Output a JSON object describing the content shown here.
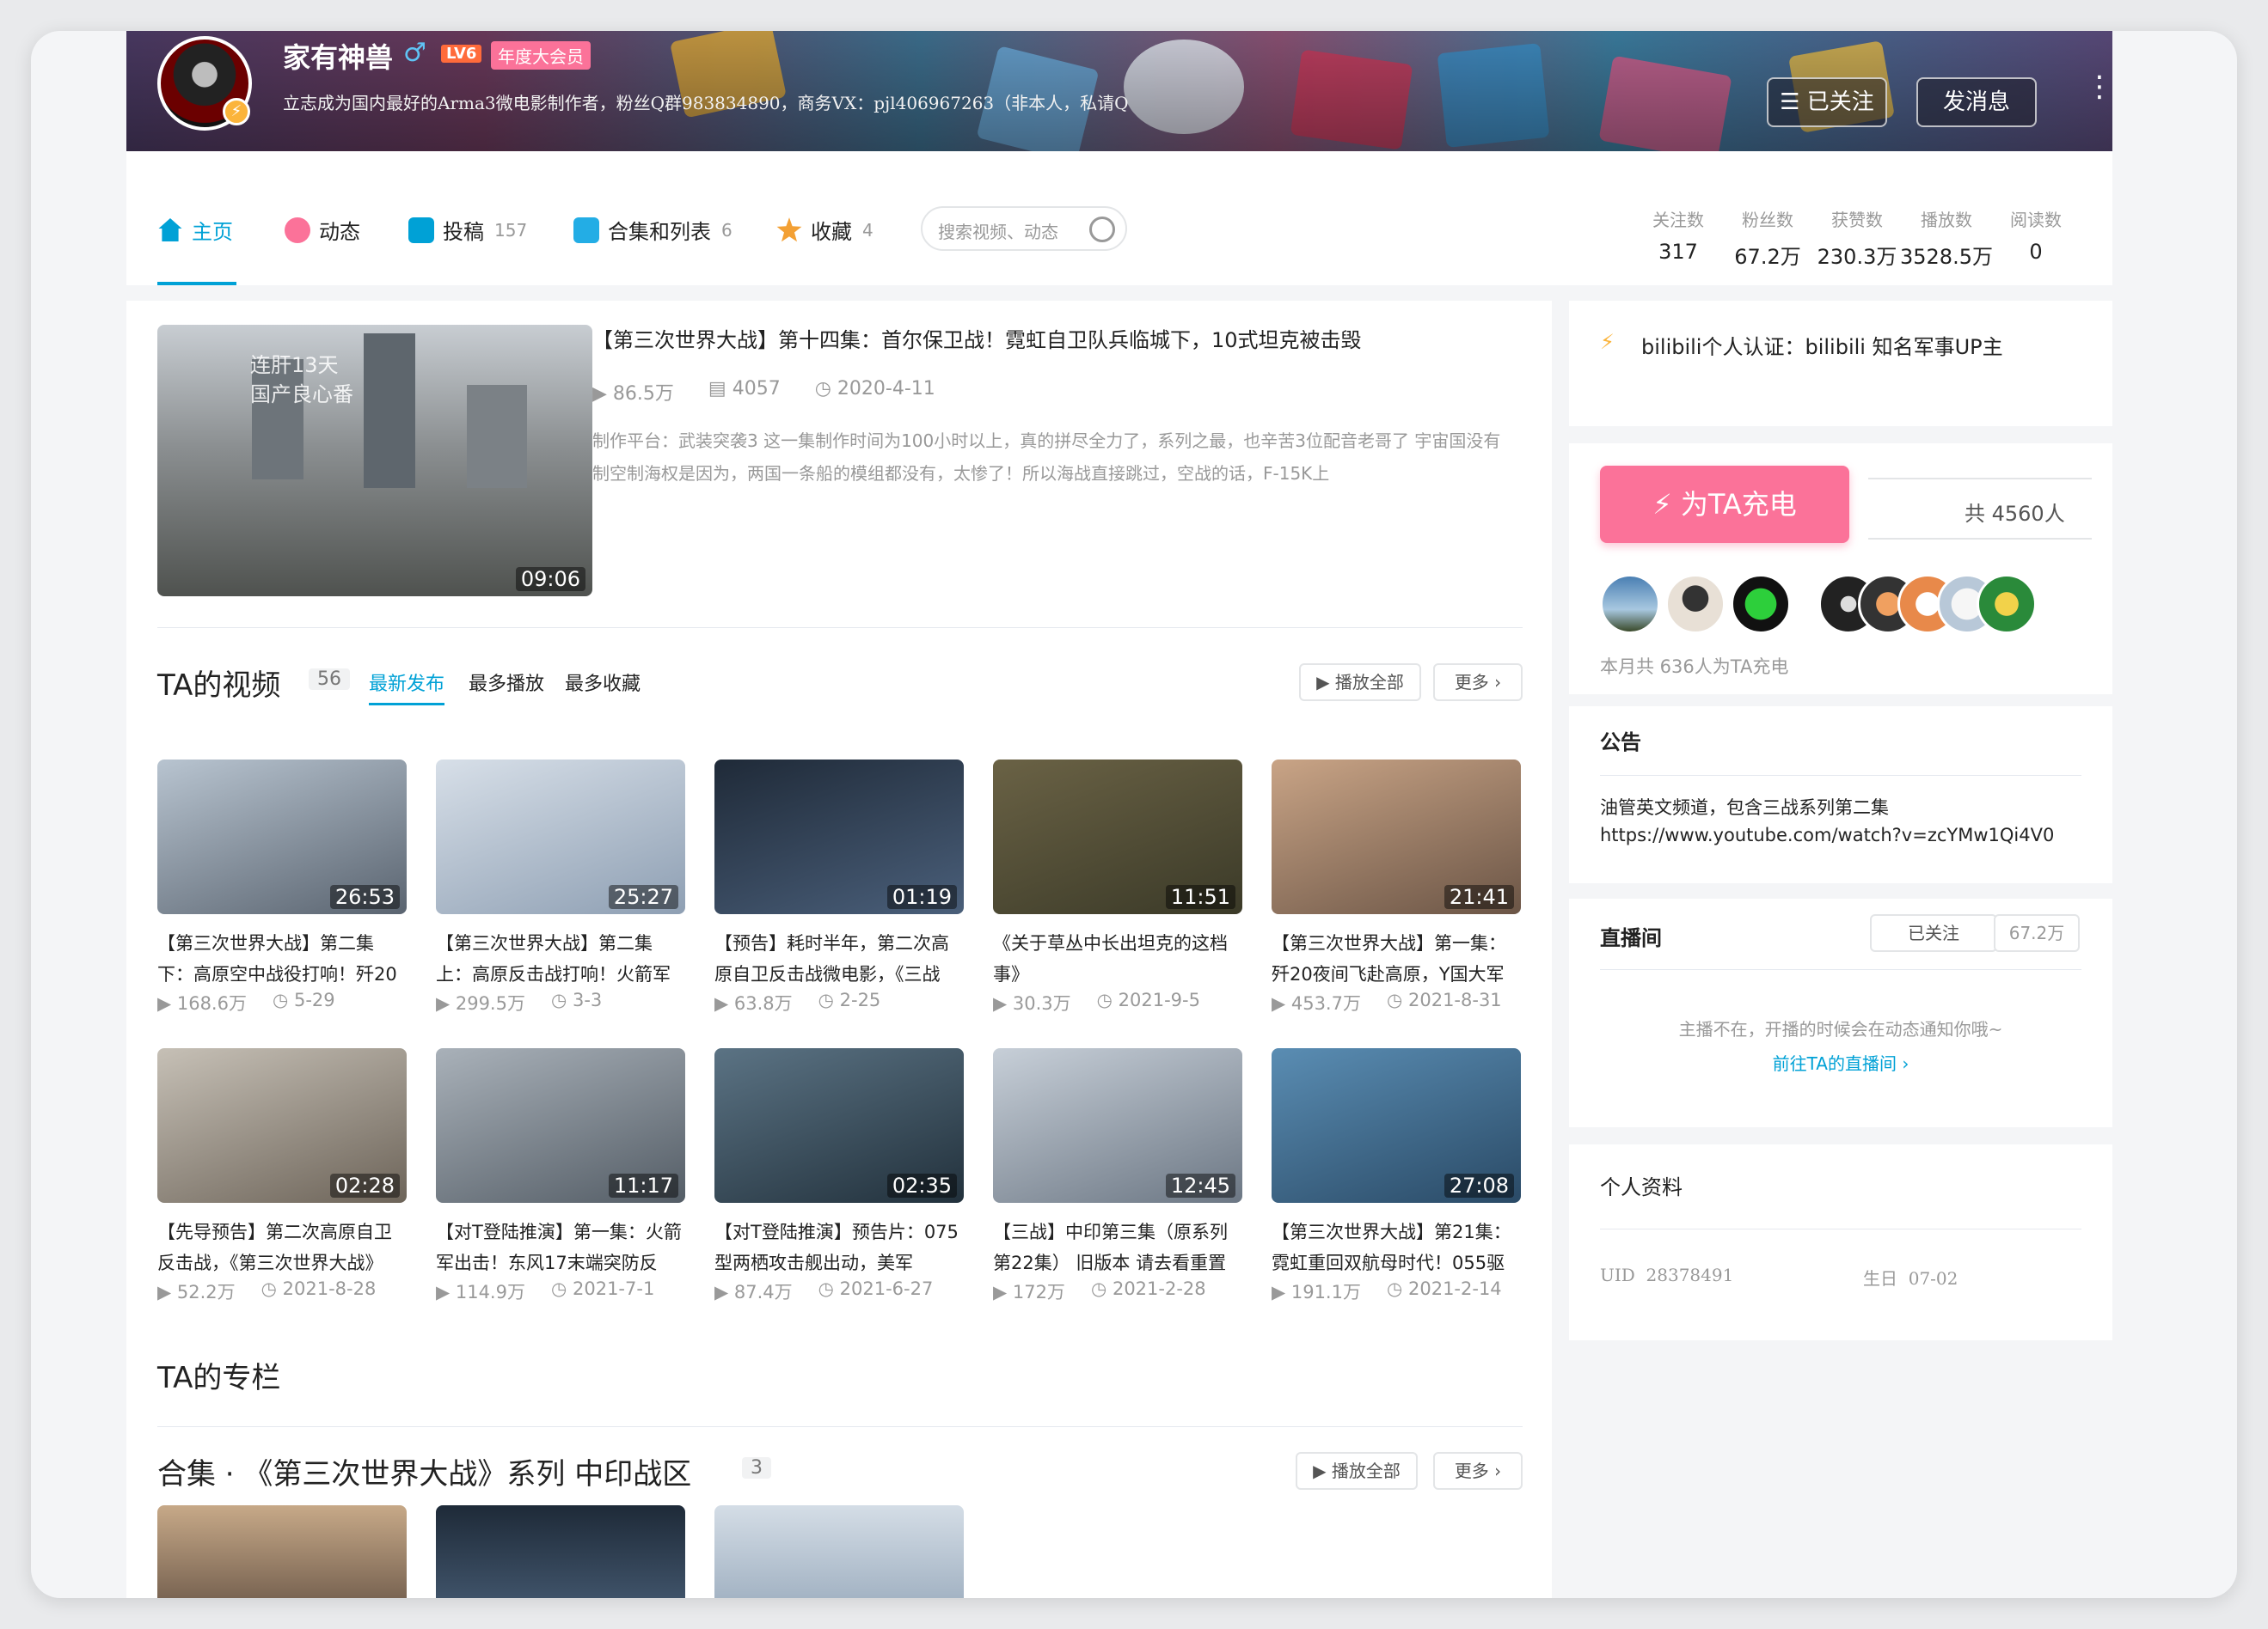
{
  "header": {
    "username": "家有神兽",
    "gender_symbol": "♂",
    "level": "LV6",
    "vip_label": "年度大会员",
    "signature": "立志成为国内最好的Arma3微电影制作者，粉丝Q群983834890，商务VX：pjl406967263（非本人，私请Q",
    "followed_label": "☰ 已关注",
    "message_label": "发消息"
  },
  "nav": {
    "tabs": [
      {
        "label": "主页",
        "count": ""
      },
      {
        "label": "动态",
        "count": ""
      },
      {
        "label": "投稿",
        "count": "157"
      },
      {
        "label": "合集和列表",
        "count": "6"
      },
      {
        "label": "收藏",
        "count": "4"
      }
    ],
    "search_placeholder": "搜索视频、动态",
    "stats": [
      {
        "label": "关注数",
        "value": "317"
      },
      {
        "label": "粉丝数",
        "value": "67.2万"
      },
      {
        "label": "获赞数",
        "value": "230.3万"
      },
      {
        "label": "播放数",
        "value": "3528.5万"
      },
      {
        "label": "阅读数",
        "value": "0"
      }
    ]
  },
  "top_video": {
    "thumb_overlay": "连肝13天\n国产良心番",
    "duration": "09:06",
    "title": "【第三次世界大战】第十四集：首尔保卫战！霓虹自卫队兵临城下，10式坦克被击毁",
    "plays": "86.5万",
    "danmaku": "4057",
    "date": "2020-4-11",
    "desc": "制作平台：武装突袭3 这一集制作时间为100小时以上，真的拼尽全力了，系列之最，也辛苦3位配音老哥了 宇宙国没有制空制海权是因为，两国一条船的模组都没有，太惨了！所以海战直接跳过，空战的话，F-15K上"
  },
  "videos_section": {
    "title": "TA的视频",
    "count": "56",
    "tabs": [
      "最新发布",
      "最多播放",
      "最多收藏"
    ],
    "play_all": "播放全部",
    "more": "更多",
    "items": [
      {
        "title": "【第三次世界大战】第二集下：高原空中战役打响！歼20",
        "duration": "26:53",
        "plays": "168.6万",
        "date": "5-29",
        "c1": "#b8c4d0",
        "c2": "#5a6470"
      },
      {
        "title": "【第三次世界大战】第二集上：高原反击战打响！火箭军",
        "duration": "25:27",
        "plays": "299.5万",
        "date": "3-3",
        "c1": "#d7dfe8",
        "c2": "#8e9fb3"
      },
      {
        "title": "【预告】耗时半年，第二次高原自卫反击战微电影，《三战",
        "duration": "01:19",
        "plays": "63.8万",
        "date": "2-25",
        "c1": "#1f2a38",
        "c2": "#4a5f7a"
      },
      {
        "title": "《关于草丛中长出坦克的这档事》",
        "duration": "11:51",
        "plays": "30.3万",
        "date": "2021-9-5",
        "c1": "#6a6245",
        "c2": "#3b3a28"
      },
      {
        "title": "【第三次世界大战】第一集：歼20夜间飞赴高原，Y国大军",
        "duration": "21:41",
        "plays": "453.7万",
        "date": "2021-8-31",
        "c1": "#c9a486",
        "c2": "#6b5546"
      },
      {
        "title": "【先导预告】第二次高原自卫反击战，《第三次世界大战》",
        "duration": "02:28",
        "plays": "52.2万",
        "date": "2021-8-28",
        "c1": "#c6c0b6",
        "c2": "#6d6459"
      },
      {
        "title": "【对T登陆推演】第一集：火箭军出击！东风17末端突防反",
        "duration": "11:17",
        "plays": "114.9万",
        "date": "2021-7-1",
        "c1": "#a9b1b9",
        "c2": "#545d66"
      },
      {
        "title": "【对T登陆推演】预告片：075型两栖攻击舰出动，美军",
        "duration": "02:35",
        "plays": "87.4万",
        "date": "2021-6-27",
        "c1": "#5b7384",
        "c2": "#22313c"
      },
      {
        "title": "【三战】中印第三集（原系列第22集） 旧版本 请去看重置",
        "duration": "12:45",
        "plays": "172万",
        "date": "2021-2-28",
        "c1": "#c7cfd8",
        "c2": "#6c7784"
      },
      {
        "title": "【第三次世界大战】第21集：霓虹重回双航母时代！055驱",
        "duration": "27:08",
        "plays": "191.1万",
        "date": "2021-2-14",
        "c1": "#5a8db3",
        "c2": "#2a4a66"
      }
    ]
  },
  "column_section": {
    "title": "TA的专栏"
  },
  "collection_section": {
    "title": "合集 · 《第三次世界大战》系列 中印战区",
    "count": "3",
    "play_all": "播放全部",
    "more": "更多"
  },
  "sidebar": {
    "cert": "bilibili个人认证：bilibili 知名军事UP主",
    "charge_label": "为TA充电",
    "charge_total": "共 4560人",
    "charge_month": "本月共 636人为TA充电",
    "notice_title": "公告",
    "notice_text_1": "油管英文频道，包含三战系列第二集",
    "notice_text_2": "https://www.youtube.com/watch?v=zcYMw1Qi4V0",
    "live_title": "直播间",
    "live_follow": "已关注",
    "live_fans": "67.2万",
    "live_off": "主播不在，开播的时候会在动态通知你哦~",
    "live_link": "前往TA的直播间",
    "profile_title": "个人资料",
    "uid_label": "UID",
    "uid_value": "28378491",
    "birthday_label": "生日",
    "birthday_value": "07-02"
  },
  "colors": {
    "accent": "#00a1d6",
    "pink": "#fb7299",
    "muted": "#999999"
  }
}
